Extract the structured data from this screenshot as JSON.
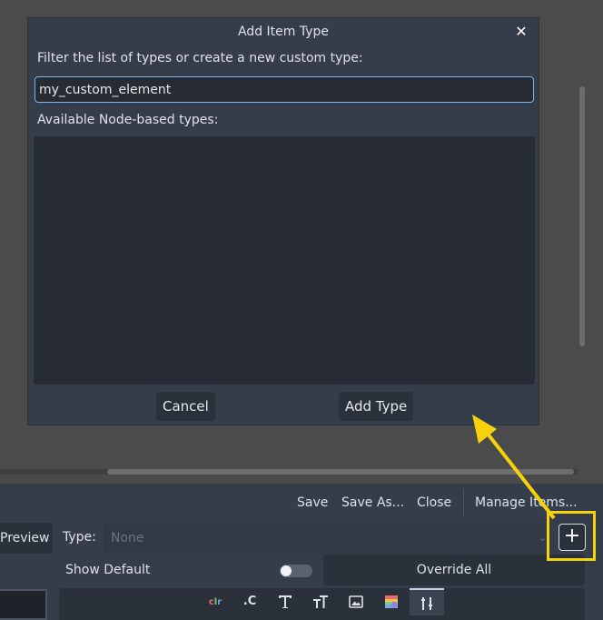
{
  "dialog": {
    "title": "Add Item Type",
    "filter_label": "Filter the list of types or create a new custom type:",
    "input_value": "my_custom_element",
    "available_label": "Available Node-based types:",
    "cancel_label": "Cancel",
    "add_type_label": "Add Type",
    "close_icon": "close-icon"
  },
  "toolbar": {
    "save_label": "Save",
    "save_as_label": "Save As...",
    "close_label": "Close",
    "manage_items_label": "Manage Items..."
  },
  "editor": {
    "preview_label": "Preview",
    "type_label": "Type:",
    "type_value": "None",
    "add_icon": "plus-icon",
    "show_default_label": "Show Default",
    "override_all_label": "Override All"
  },
  "tabs": [
    {
      "icon": "color-icon",
      "label": "clr"
    },
    {
      "icon": "constant-icon",
      "label": ".C"
    },
    {
      "icon": "font-icon"
    },
    {
      "icon": "font-size-icon"
    },
    {
      "icon": "image-icon"
    },
    {
      "icon": "stylebox-icon"
    },
    {
      "icon": "theme-tools-icon"
    }
  ],
  "colors": {
    "accent_highlight": "#f5d20c",
    "dialog_bg": "#363d4a",
    "input_border": "#7fb6f2"
  }
}
